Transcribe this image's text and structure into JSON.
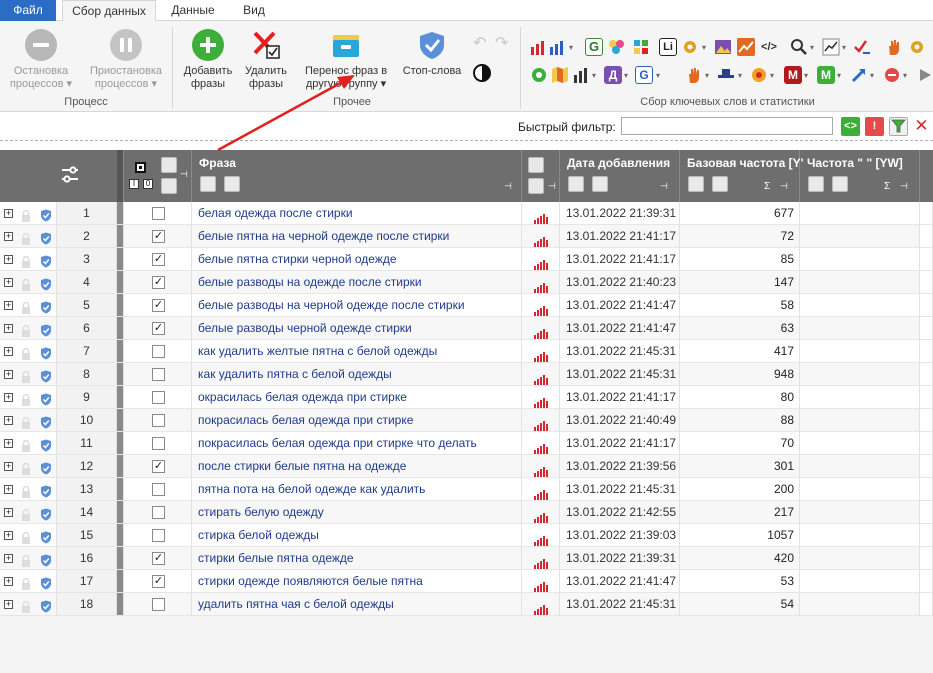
{
  "tabs": {
    "file": "Файл",
    "collect": "Сбор данных",
    "data": "Данные",
    "view": "Вид"
  },
  "ribbon": {
    "process": {
      "stop_label_1": "Остановка",
      "stop_label_2": "процессов",
      "pause_label_1": "Приостановка",
      "pause_label_2": "процессов",
      "group": "Процесс"
    },
    "other": {
      "add_label_1": "Добавить",
      "add_label_2": "фразы",
      "delete_label_1": "Удалить",
      "delete_label_2": "фразы",
      "move_label_1": "Перенос фраз в",
      "move_label_2": "другую группу",
      "stopwords_label": "Стоп-слова",
      "group": "Прочее"
    },
    "keywords_group": "Сбор ключевых слов и статистики"
  },
  "filter": {
    "label": "Быстрый фильтр:",
    "value": ""
  },
  "columns": {
    "phrase": "Фраза",
    "date": "Дата добавления",
    "base_freq": "Базовая частота [Y'",
    "freq2": "Частота \" \" [YW]",
    "sigma": "Σ"
  },
  "rows": [
    {
      "num": "1",
      "checked": false,
      "phrase": "белая одежда после стирки",
      "date": "13.01.2022 21:39:31",
      "freq": "677"
    },
    {
      "num": "2",
      "checked": true,
      "phrase": "белые пятна на черной одежде после стирки",
      "date": "13.01.2022 21:41:17",
      "freq": "72"
    },
    {
      "num": "3",
      "checked": true,
      "phrase": "белые пятна стирки черной одежде",
      "date": "13.01.2022 21:41:17",
      "freq": "85"
    },
    {
      "num": "4",
      "checked": true,
      "phrase": "белые разводы на одежде после стирки",
      "date": "13.01.2022 21:40:23",
      "freq": "147"
    },
    {
      "num": "5",
      "checked": true,
      "phrase": "белые разводы на черной одежде после стирки",
      "date": "13.01.2022 21:41:47",
      "freq": "58"
    },
    {
      "num": "6",
      "checked": true,
      "phrase": "белые разводы черной одежде стирки",
      "date": "13.01.2022 21:41:47",
      "freq": "63"
    },
    {
      "num": "7",
      "checked": false,
      "phrase": "как удалить желтые пятна с белой одежды",
      "date": "13.01.2022 21:45:31",
      "freq": "417"
    },
    {
      "num": "8",
      "checked": false,
      "phrase": "как удалить пятна с белой одежды",
      "date": "13.01.2022 21:45:31",
      "freq": "948"
    },
    {
      "num": "9",
      "checked": false,
      "phrase": "окрасилась белая одежда при стирке",
      "date": "13.01.2022 21:41:17",
      "freq": "80"
    },
    {
      "num": "10",
      "checked": false,
      "phrase": "покрасилась белая одежда при стирке",
      "date": "13.01.2022 21:40:49",
      "freq": "88"
    },
    {
      "num": "11",
      "checked": false,
      "phrase": "покрасилась белая одежда при стирке что делать",
      "date": "13.01.2022 21:41:17",
      "freq": "70"
    },
    {
      "num": "12",
      "checked": true,
      "phrase": "после стирки белые пятна на одежде",
      "date": "13.01.2022 21:39:56",
      "freq": "301"
    },
    {
      "num": "13",
      "checked": false,
      "phrase": "пятна пота на белой одежде как удалить",
      "date": "13.01.2022 21:45:31",
      "freq": "200"
    },
    {
      "num": "14",
      "checked": false,
      "phrase": "стирать белую одежду",
      "date": "13.01.2022 21:42:55",
      "freq": "217"
    },
    {
      "num": "15",
      "checked": false,
      "phrase": "стирка белой одежды",
      "date": "13.01.2022 21:39:03",
      "freq": "1057"
    },
    {
      "num": "16",
      "checked": true,
      "phrase": "стирки белые пятна одежде",
      "date": "13.01.2022 21:39:31",
      "freq": "420"
    },
    {
      "num": "17",
      "checked": true,
      "phrase": "стирки одежде появляются белые пятна",
      "date": "13.01.2022 21:41:47",
      "freq": "53"
    },
    {
      "num": "18",
      "checked": false,
      "phrase": "удалить пятна чая с белой одежды",
      "date": "13.01.2022 21:45:31",
      "freq": "54"
    }
  ],
  "colors": {
    "accent": "#2b6cc4",
    "header_bg": "#6e6e6e",
    "link": "#1f3a8c",
    "bar_red": "#d8262f",
    "add_green": "#3dae3a",
    "arrow_red": "#e32020"
  },
  "icons": {
    "stop": "stop-circle-icon",
    "pause": "pause-circle-icon",
    "add": "plus-circle-icon",
    "delete": "cross-checkbox-icon",
    "move": "folder-icon",
    "stopwords": "shield-icon",
    "contrast": "contrast-icon"
  }
}
